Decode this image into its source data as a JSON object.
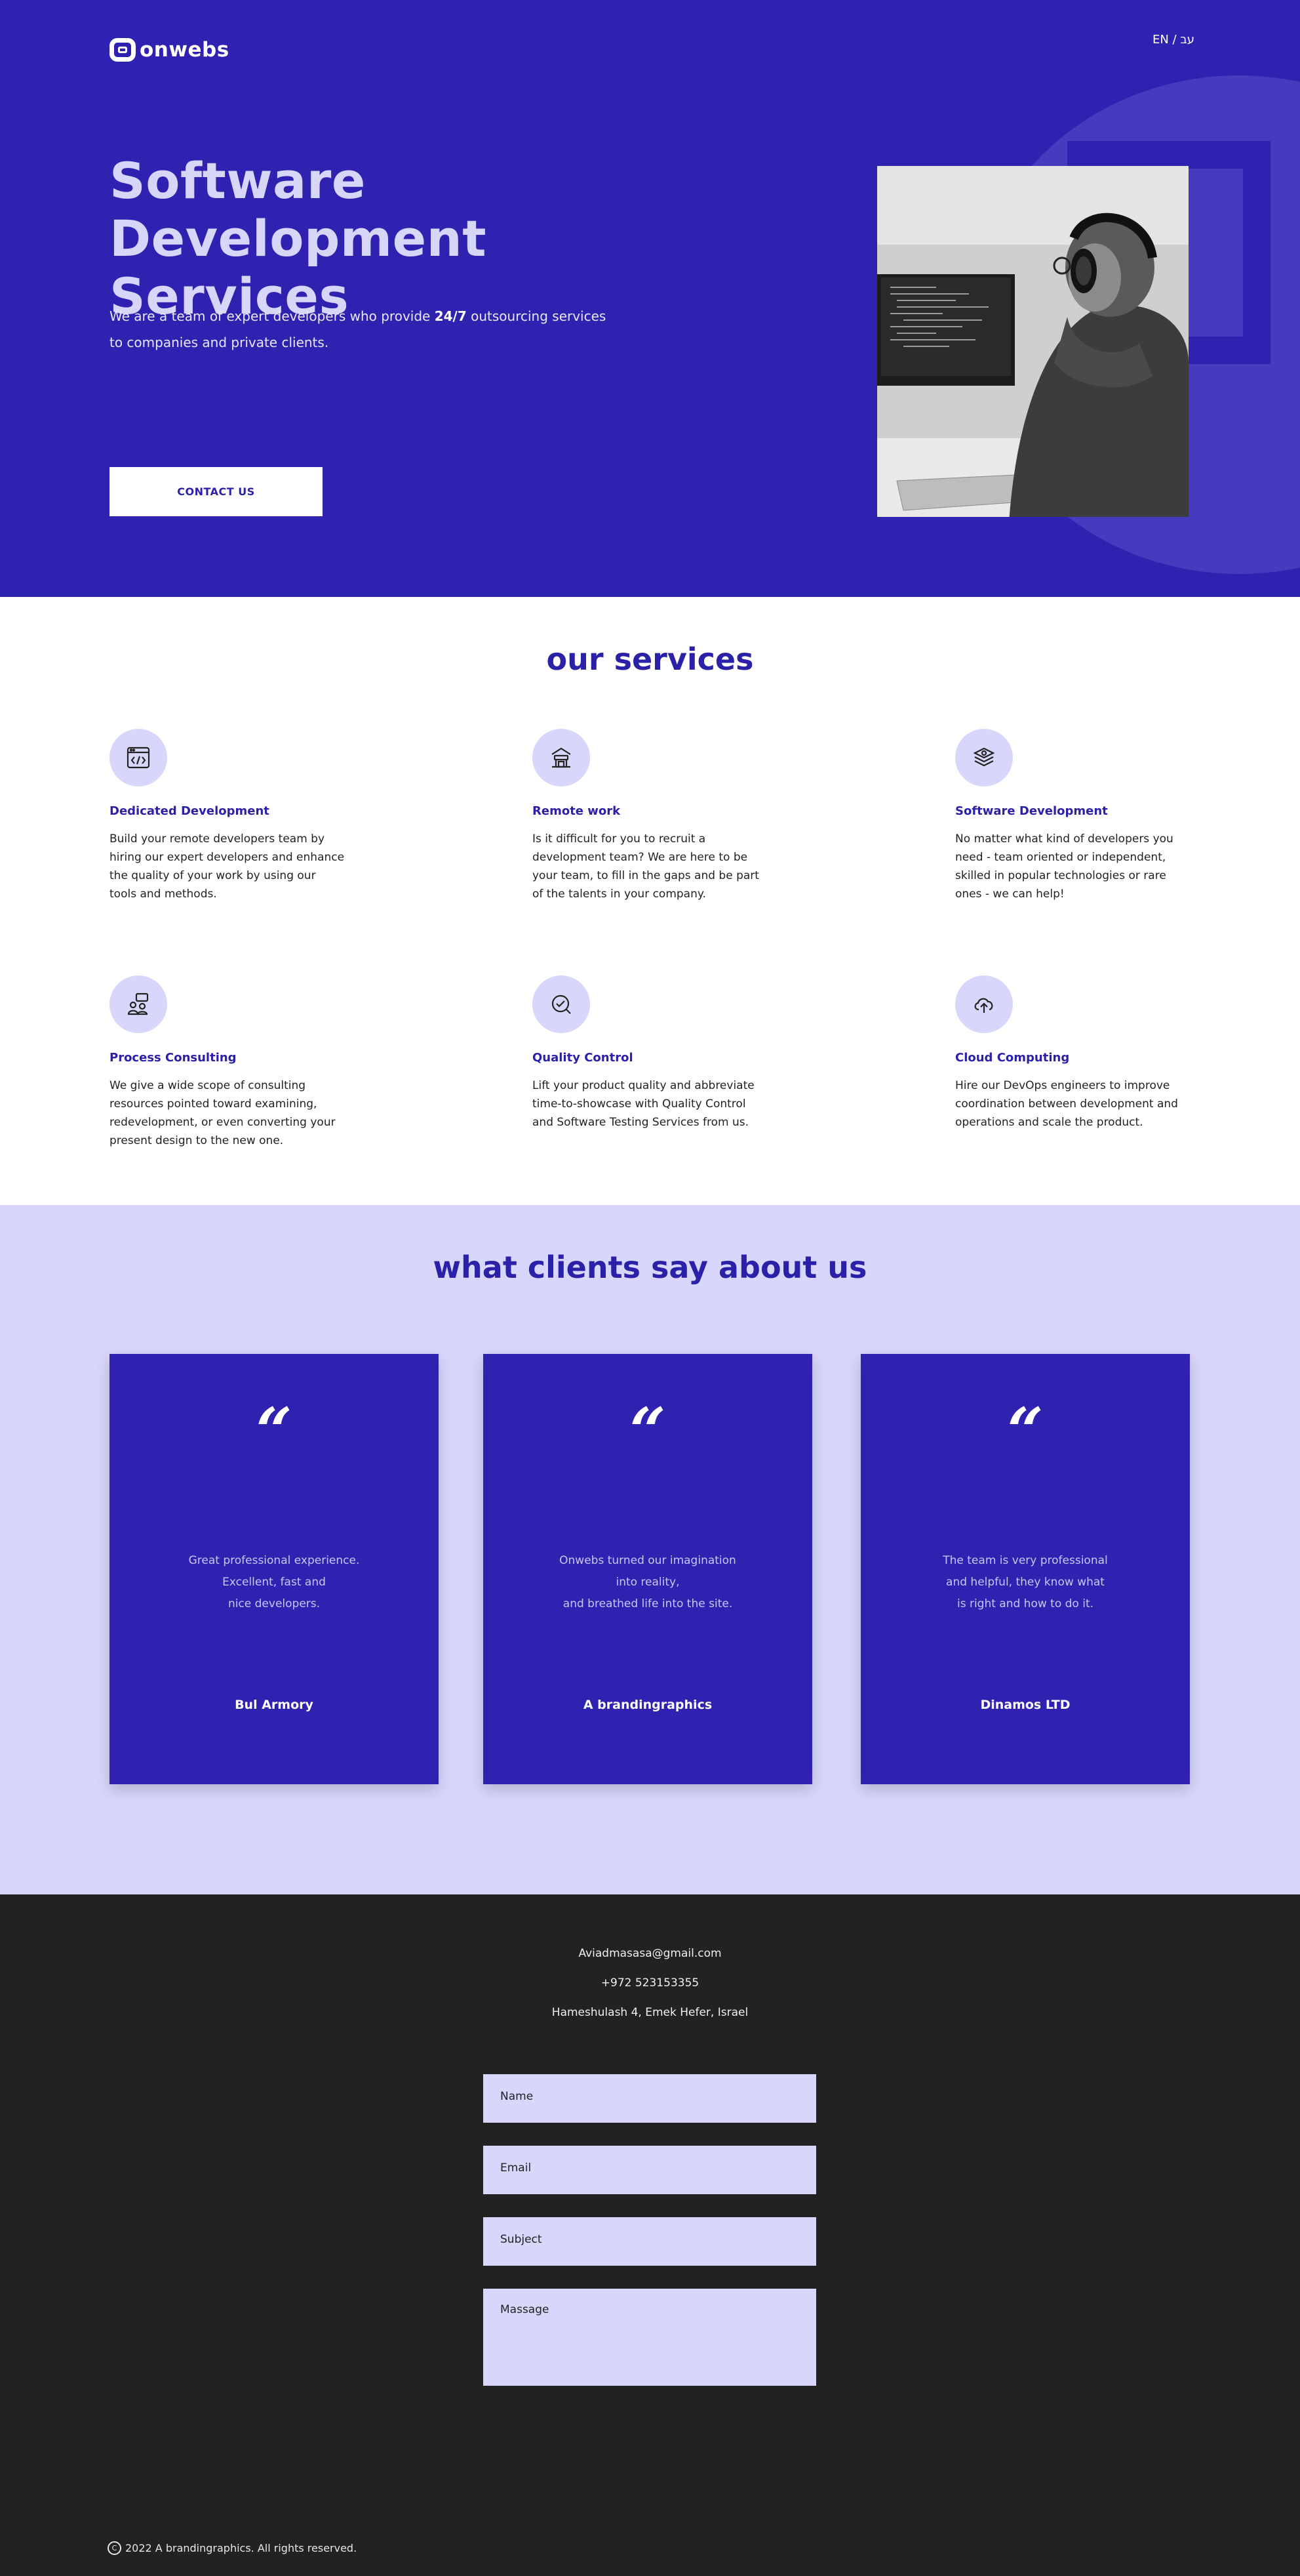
{
  "header": {
    "logo_text": "onwebs",
    "lang_switch": "EN / עב"
  },
  "hero": {
    "title_line1": "Software Development",
    "title_line2": "Services",
    "lead_part1": "We are a team of expert developers who provide ",
    "lead_bold": "24/7",
    "lead_part2": " outsourcing services",
    "lead_line2": "to companies and private clients.",
    "cta_label": "CONTACT US"
  },
  "services": {
    "title": "our services",
    "items": [
      {
        "title": "Dedicated Development",
        "icon": "code-window-icon",
        "text": "Build your remote developers team by hiring our expert developers and enhance the quality of your work by using our tools and methods."
      },
      {
        "title": "Remote work",
        "icon": "remote-desk-icon",
        "text": "Is it difficult for you to recruit a development team? We are here to be your team, to fill in the gaps and be part of the talents in your company."
      },
      {
        "title": "Software Development",
        "icon": "layers-icon",
        "text": "No matter what kind of developers you need - team oriented or independent, skilled in popular technologies or rare ones - we can help!"
      },
      {
        "title": "Process Consulting",
        "icon": "consulting-icon",
        "text": "We give a wide scope of consulting resources pointed toward examining, redevelopment, or even converting your present design to the new one."
      },
      {
        "title": "Quality Control",
        "icon": "quality-check-icon",
        "text": "Lift your product quality and abbreviate time-to-showcase with Quality Control and Software Testing Services from us."
      },
      {
        "title": "Cloud Computing",
        "icon": "cloud-upload-icon",
        "text": "Hire our DevOps engineers to improve coordination between development and operations and scale the product."
      }
    ]
  },
  "testimonials": {
    "title": "what clients say about us",
    "quote_mark": "“",
    "items": [
      {
        "text": "Great professional experience.\nExcellent, fast and\nnice developers.",
        "name": "Bul Armory"
      },
      {
        "text": "Onwebs turned our imagination\ninto reality,\nand breathed life into the site.",
        "name": "A brandingraphics"
      },
      {
        "text": "The team is very professional\nand helpful, they know what\nis right and how to do it.",
        "name": "Dinamos LTD"
      }
    ]
  },
  "footer": {
    "email": "Aviadmasasa@gmail.com",
    "phone": "+972 523153355",
    "address": "Hameshulash 4, Emek Hefer, Israel",
    "form": {
      "name_placeholder": "Name",
      "email_placeholder": "Email",
      "subject_placeholder": "Subject",
      "message_placeholder": "Massage"
    },
    "copyright_symbol": "C",
    "copyright": "2022 A brandingraphics. All rights reserved."
  },
  "colors": {
    "brand_blue": "#3022b1",
    "lavender": "#d8d7fb",
    "footer_dark": "#222222"
  }
}
